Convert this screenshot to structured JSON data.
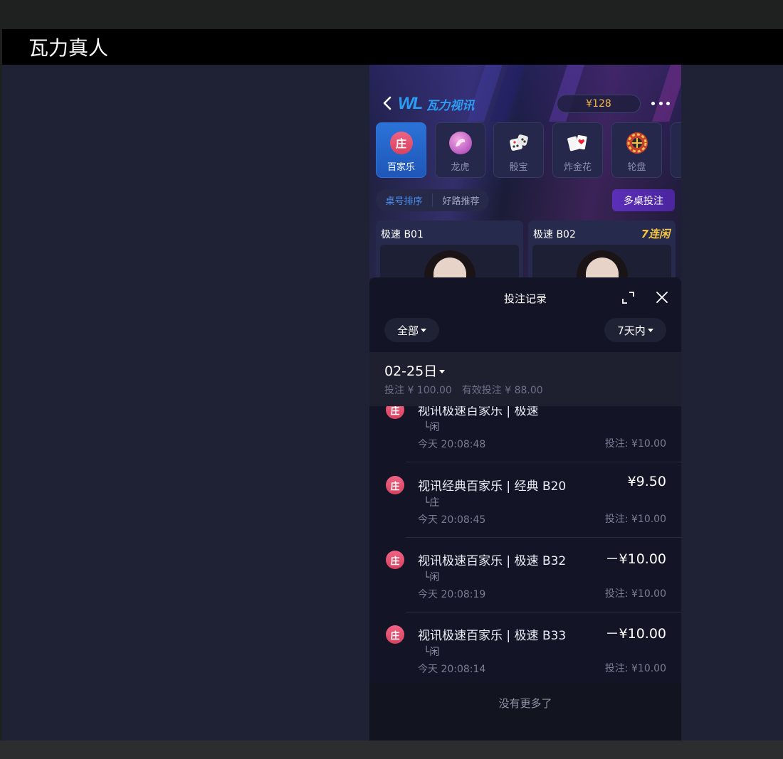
{
  "window": {
    "title": "瓦力真人"
  },
  "header": {
    "logo_mark": "WL",
    "logo_text": "瓦力视讯",
    "balance": "¥128"
  },
  "game_tabs": [
    {
      "label": "百家乐",
      "icon": "庄",
      "active": true
    },
    {
      "label": "龙虎",
      "icon": "dragon-icon",
      "active": false
    },
    {
      "label": "骰宝",
      "icon": "dice-icon",
      "active": false
    },
    {
      "label": "炸金花",
      "icon": "cards-icon",
      "active": false
    },
    {
      "label": "轮盘",
      "icon": "roulette-icon",
      "active": false
    }
  ],
  "sort": {
    "table_order": "桌号排序",
    "good_road": "好路推荐"
  },
  "multi_table_button": "多桌投注",
  "tables": [
    {
      "name": "极速 B01",
      "badge": ""
    },
    {
      "name": "极速 B02",
      "badge": "7连闲"
    }
  ],
  "sheet": {
    "title": "投注记录",
    "filter_type": "全部",
    "filter_period": "7天内",
    "date": "02-25日",
    "summary_bet": "投注 ¥ 100.00",
    "summary_valid": "有效投注 ¥ 88.00"
  },
  "records": [
    {
      "icon": "庄",
      "title": "视讯极速百家乐 | 极速",
      "amount": "",
      "pick": "└闲",
      "time": "今天 20:08:48",
      "bet": "投注: ¥10.00"
    },
    {
      "icon": "庄",
      "title": "视讯经典百家乐 | 经典 B20",
      "amount": "¥9.50",
      "pick": "└庄",
      "time": "今天 20:08:45",
      "bet": "投注: ¥10.00"
    },
    {
      "icon": "庄",
      "title": "视讯极速百家乐 | 极速 B32",
      "amount": "－¥10.00",
      "pick": "└闲",
      "time": "今天 20:08:19",
      "bet": "投注: ¥10.00"
    },
    {
      "icon": "庄",
      "title": "视讯极速百家乐 | 极速 B33",
      "amount": "－¥10.00",
      "pick": "└闲",
      "time": "今天 20:08:14",
      "bet": "投注: ¥10.00"
    }
  ],
  "footer": {
    "no_more": "没有更多了"
  },
  "colors": {
    "accent": "#2b73d8",
    "multi_btn": "#5b2fb8",
    "balance": "#f4b84a",
    "streak": "#f6c443",
    "banker_icon": "#f06384"
  }
}
